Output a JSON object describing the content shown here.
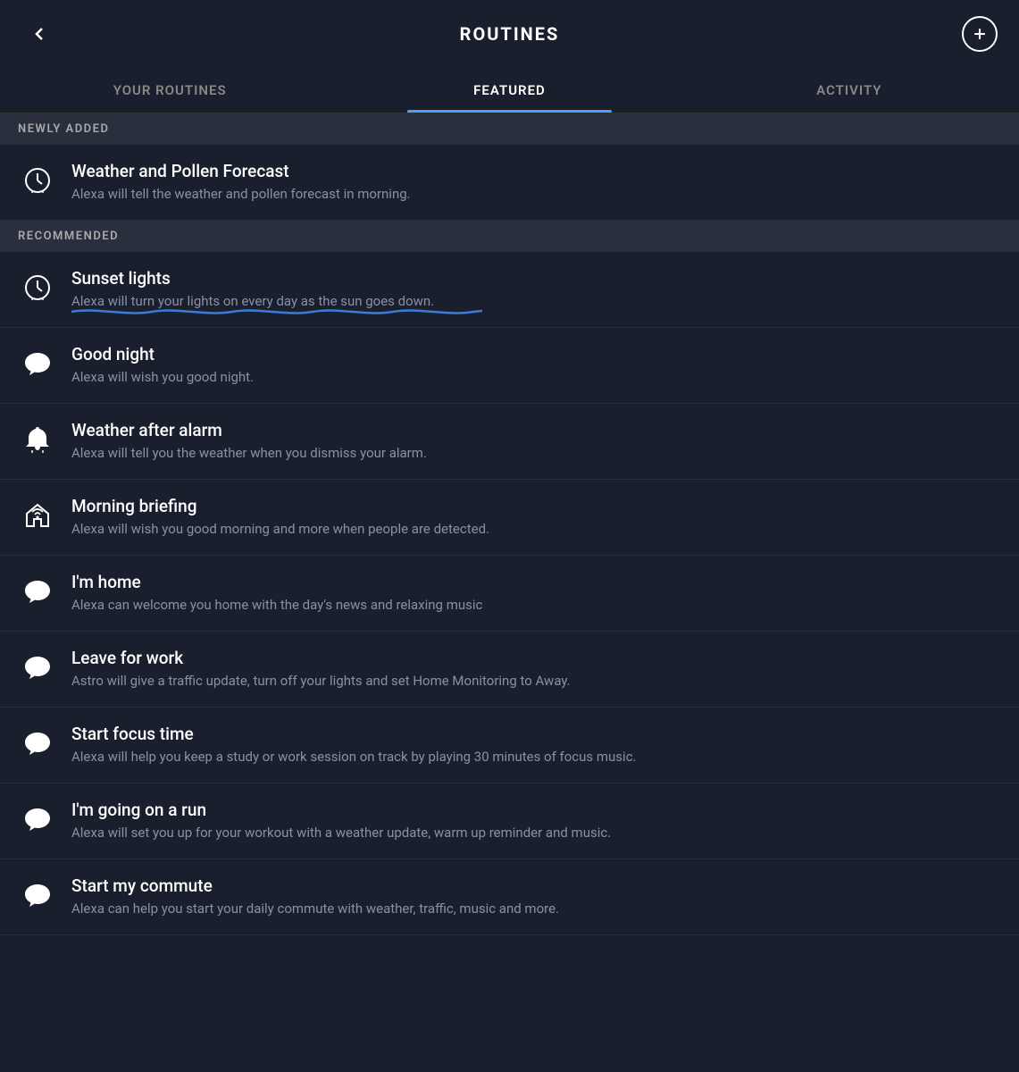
{
  "header": {
    "title": "ROUTINES",
    "back_label": "back",
    "add_label": "add"
  },
  "tabs": [
    {
      "id": "your-routines",
      "label": "YOUR ROUTINES",
      "active": false
    },
    {
      "id": "featured",
      "label": "FEATURED",
      "active": true
    },
    {
      "id": "activity",
      "label": "ACTIVITY",
      "active": false
    }
  ],
  "sections": [
    {
      "id": "newly-added",
      "label": "NEWLY ADDED",
      "items": [
        {
          "id": "weather-pollen",
          "title": "Weather and Pollen Forecast",
          "description": "Alexa will tell the weather and pollen forecast in morning.",
          "icon": "clock"
        }
      ]
    },
    {
      "id": "recommended",
      "label": "RECOMMENDED",
      "items": [
        {
          "id": "sunset-lights",
          "title": "Sunset lights",
          "description": "Alexa will turn your lights on every day as the sun goes down.",
          "icon": "clock",
          "squiggle": true
        },
        {
          "id": "good-night",
          "title": "Good night",
          "description": "Alexa will wish you good night.",
          "icon": "speech"
        },
        {
          "id": "weather-after-alarm",
          "title": "Weather after alarm",
          "description": "Alexa will tell you the weather when you dismiss your alarm.",
          "icon": "bell"
        },
        {
          "id": "morning-briefing",
          "title": "Morning briefing",
          "description": "Alexa will wish you good morning and more when people are detected.",
          "icon": "wifi-home"
        },
        {
          "id": "im-home",
          "title": "I'm home",
          "description": "Alexa can welcome you home with the day's news and relaxing music",
          "icon": "speech"
        },
        {
          "id": "leave-for-work",
          "title": "Leave for work",
          "description": "Astro will give a traffic update, turn off your lights and set Home Monitoring to Away.",
          "icon": "speech"
        },
        {
          "id": "start-focus-time",
          "title": "Start focus time",
          "description": "Alexa will help you keep a study or work session on track by playing 30 minutes of focus music.",
          "icon": "speech"
        },
        {
          "id": "im-going-on-a-run",
          "title": "I'm going on a run",
          "description": "Alexa will set you up for your workout with a weather update, warm up reminder and music.",
          "icon": "speech"
        },
        {
          "id": "start-my-commute",
          "title": "Start my commute",
          "description": "Alexa can help you start your daily commute with weather, traffic, music and more.",
          "icon": "speech"
        }
      ]
    }
  ]
}
